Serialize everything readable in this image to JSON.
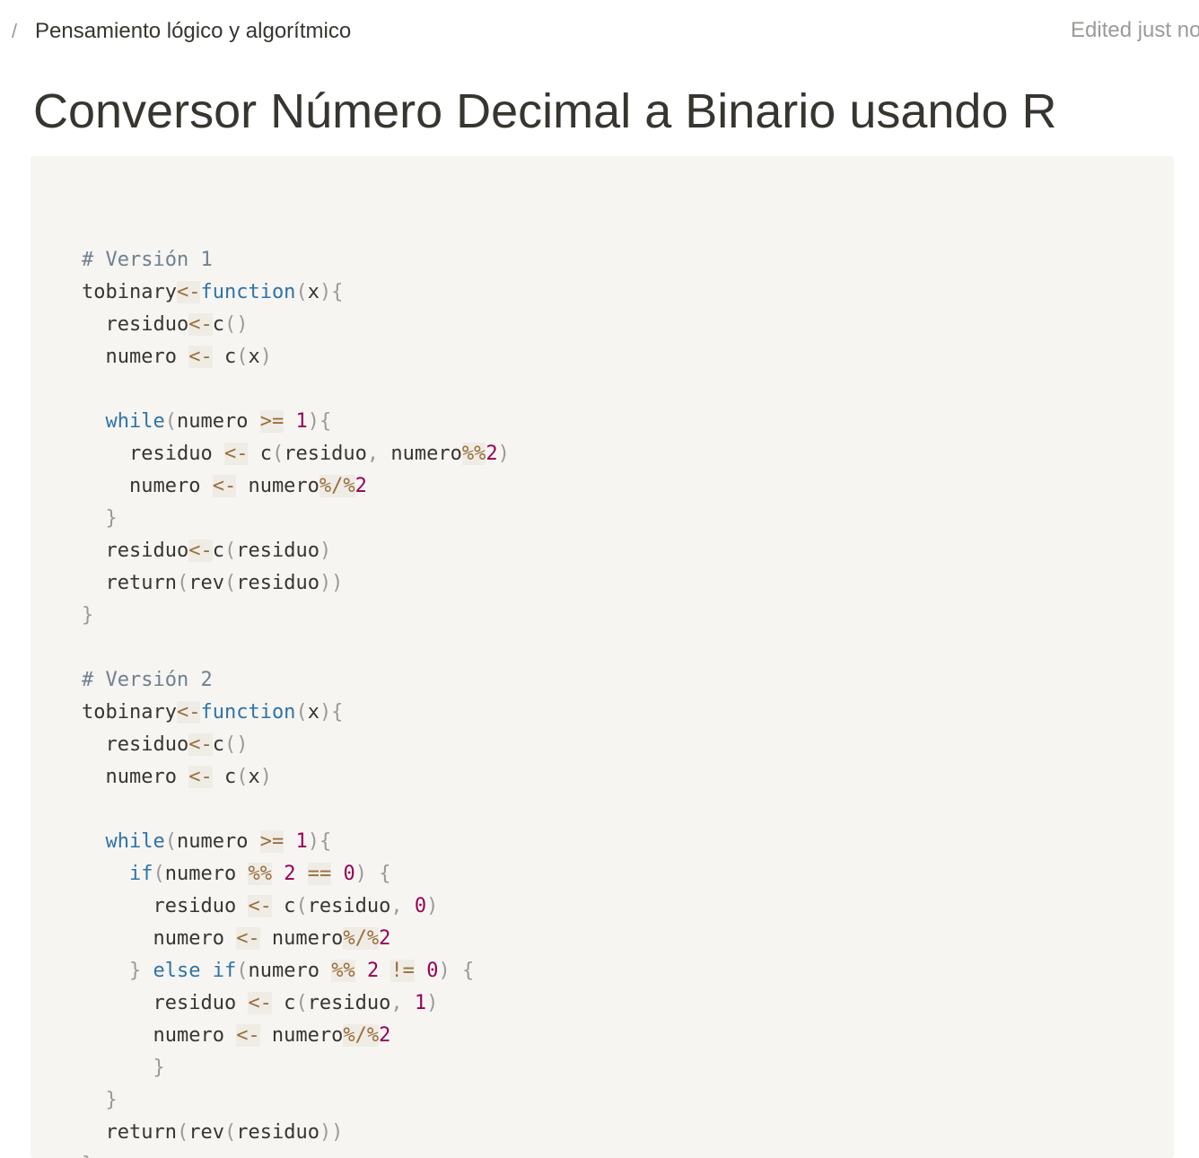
{
  "breadcrumb": {
    "separator": "/",
    "page": "Pensamiento lógico y algorítmico"
  },
  "status": {
    "edited": "Edited just no"
  },
  "page": {
    "title": "Conversor Número Decimal a Binario usando R"
  },
  "code_block": {
    "language": "R",
    "lines": [
      [],
      [
        [
          "comment",
          "# Versión 1"
        ]
      ],
      [
        [
          "plain",
          "tobinary"
        ],
        [
          "operator",
          "<-"
        ],
        [
          "keyword",
          "function"
        ],
        [
          "punct",
          "("
        ],
        [
          "plain",
          "x"
        ],
        [
          "punct",
          "){"
        ]
      ],
      [
        [
          "plain",
          "  residuo"
        ],
        [
          "operator",
          "<-"
        ],
        [
          "plain",
          "c"
        ],
        [
          "punct",
          "()"
        ]
      ],
      [
        [
          "plain",
          "  numero "
        ],
        [
          "operator",
          "<-"
        ],
        [
          "plain",
          " c"
        ],
        [
          "punct",
          "("
        ],
        [
          "plain",
          "x"
        ],
        [
          "punct",
          ")"
        ]
      ],
      [],
      [
        [
          "plain",
          "  "
        ],
        [
          "keyword",
          "while"
        ],
        [
          "punct",
          "("
        ],
        [
          "plain",
          "numero "
        ],
        [
          "operator",
          ">="
        ],
        [
          "plain",
          " "
        ],
        [
          "number",
          "1"
        ],
        [
          "punct",
          "){"
        ]
      ],
      [
        [
          "plain",
          "    residuo "
        ],
        [
          "operator",
          "<-"
        ],
        [
          "plain",
          " c"
        ],
        [
          "punct",
          "("
        ],
        [
          "plain",
          "residuo"
        ],
        [
          "punct",
          ","
        ],
        [
          "plain",
          " numero"
        ],
        [
          "operator",
          "%%"
        ],
        [
          "number",
          "2"
        ],
        [
          "punct",
          ")"
        ]
      ],
      [
        [
          "plain",
          "    numero "
        ],
        [
          "operator",
          "<-"
        ],
        [
          "plain",
          " numero"
        ],
        [
          "operator",
          "%/%"
        ],
        [
          "number",
          "2"
        ]
      ],
      [
        [
          "plain",
          "  "
        ],
        [
          "punct",
          "}"
        ]
      ],
      [
        [
          "plain",
          "  residuo"
        ],
        [
          "operator",
          "<-"
        ],
        [
          "plain",
          "c"
        ],
        [
          "punct",
          "("
        ],
        [
          "plain",
          "residuo"
        ],
        [
          "punct",
          ")"
        ]
      ],
      [
        [
          "plain",
          "  return"
        ],
        [
          "punct",
          "("
        ],
        [
          "plain",
          "rev"
        ],
        [
          "punct",
          "("
        ],
        [
          "plain",
          "residuo"
        ],
        [
          "punct",
          "))"
        ]
      ],
      [
        [
          "punct",
          "}"
        ]
      ],
      [],
      [
        [
          "comment",
          "# Versión 2"
        ]
      ],
      [
        [
          "plain",
          "tobinary"
        ],
        [
          "operator",
          "<-"
        ],
        [
          "keyword",
          "function"
        ],
        [
          "punct",
          "("
        ],
        [
          "plain",
          "x"
        ],
        [
          "punct",
          "){"
        ]
      ],
      [
        [
          "plain",
          "  residuo"
        ],
        [
          "operator",
          "<-"
        ],
        [
          "plain",
          "c"
        ],
        [
          "punct",
          "()"
        ]
      ],
      [
        [
          "plain",
          "  numero "
        ],
        [
          "operator",
          "<-"
        ],
        [
          "plain",
          " c"
        ],
        [
          "punct",
          "("
        ],
        [
          "plain",
          "x"
        ],
        [
          "punct",
          ")"
        ]
      ],
      [],
      [
        [
          "plain",
          "  "
        ],
        [
          "keyword",
          "while"
        ],
        [
          "punct",
          "("
        ],
        [
          "plain",
          "numero "
        ],
        [
          "operator",
          ">="
        ],
        [
          "plain",
          " "
        ],
        [
          "number",
          "1"
        ],
        [
          "punct",
          "){"
        ]
      ],
      [
        [
          "plain",
          "    "
        ],
        [
          "keyword",
          "if"
        ],
        [
          "punct",
          "("
        ],
        [
          "plain",
          "numero "
        ],
        [
          "operator",
          "%%"
        ],
        [
          "plain",
          " "
        ],
        [
          "number",
          "2"
        ],
        [
          "plain",
          " "
        ],
        [
          "operator",
          "=="
        ],
        [
          "plain",
          " "
        ],
        [
          "number",
          "0"
        ],
        [
          "punct",
          ")"
        ],
        [
          "plain",
          " "
        ],
        [
          "punct",
          "{"
        ]
      ],
      [
        [
          "plain",
          "      residuo "
        ],
        [
          "operator",
          "<-"
        ],
        [
          "plain",
          " c"
        ],
        [
          "punct",
          "("
        ],
        [
          "plain",
          "residuo"
        ],
        [
          "punct",
          ","
        ],
        [
          "plain",
          " "
        ],
        [
          "number",
          "0"
        ],
        [
          "punct",
          ")"
        ]
      ],
      [
        [
          "plain",
          "      numero "
        ],
        [
          "operator",
          "<-"
        ],
        [
          "plain",
          " numero"
        ],
        [
          "operator",
          "%/%"
        ],
        [
          "number",
          "2"
        ]
      ],
      [
        [
          "plain",
          "    "
        ],
        [
          "punct",
          "}"
        ],
        [
          "plain",
          " "
        ],
        [
          "keyword",
          "else"
        ],
        [
          "plain",
          " "
        ],
        [
          "keyword",
          "if"
        ],
        [
          "punct",
          "("
        ],
        [
          "plain",
          "numero "
        ],
        [
          "operator",
          "%%"
        ],
        [
          "plain",
          " "
        ],
        [
          "number",
          "2"
        ],
        [
          "plain",
          " "
        ],
        [
          "operator",
          "!="
        ],
        [
          "plain",
          " "
        ],
        [
          "number",
          "0"
        ],
        [
          "punct",
          ")"
        ],
        [
          "plain",
          " "
        ],
        [
          "punct",
          "{"
        ]
      ],
      [
        [
          "plain",
          "      residuo "
        ],
        [
          "operator",
          "<-"
        ],
        [
          "plain",
          " c"
        ],
        [
          "punct",
          "("
        ],
        [
          "plain",
          "residuo"
        ],
        [
          "punct",
          ","
        ],
        [
          "plain",
          " "
        ],
        [
          "number",
          "1"
        ],
        [
          "punct",
          ")"
        ]
      ],
      [
        [
          "plain",
          "      numero "
        ],
        [
          "operator",
          "<-"
        ],
        [
          "plain",
          " numero"
        ],
        [
          "operator",
          "%/%"
        ],
        [
          "number",
          "2"
        ]
      ],
      [
        [
          "plain",
          "      "
        ],
        [
          "punct",
          "}"
        ]
      ],
      [
        [
          "plain",
          "  "
        ],
        [
          "punct",
          "}"
        ]
      ],
      [
        [
          "plain",
          "  return"
        ],
        [
          "punct",
          "("
        ],
        [
          "plain",
          "rev"
        ],
        [
          "punct",
          "("
        ],
        [
          "plain",
          "residuo"
        ],
        [
          "punct",
          "))"
        ]
      ],
      [
        [
          "punct",
          "}"
        ]
      ]
    ]
  }
}
